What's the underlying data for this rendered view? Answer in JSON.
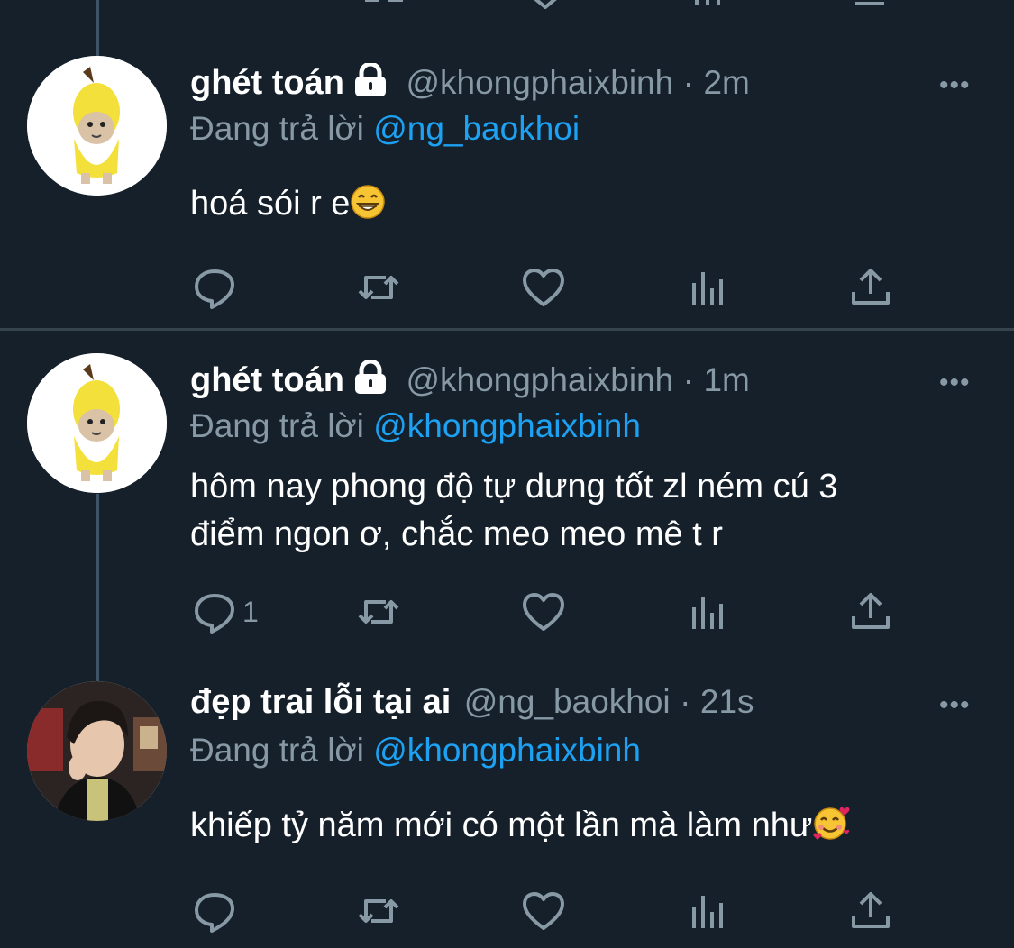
{
  "tweets": [
    {
      "display_name": "ghét toán",
      "locked": true,
      "handle": "@khongphaixbinh",
      "time": "2m",
      "reply_prefix": "Đang trả lời",
      "reply_to": "@ng_baokhoi",
      "lines": [
        "hoá sói r e"
      ],
      "emoji": "grinning-face",
      "reply_count": "",
      "avatar": "banana-cat-avatar"
    },
    {
      "display_name": "ghét toán",
      "locked": true,
      "handle": "@khongphaixbinh",
      "time": "1m",
      "reply_prefix": "Đang trả lời",
      "reply_to": "@khongphaixbinh",
      "lines": [
        "hôm nay phong độ tự dưng tốt zl ném cú 3",
        "điểm ngon ơ, chắc meo meo mê t r"
      ],
      "emoji": "",
      "reply_count": "1",
      "avatar": "banana-cat-avatar"
    },
    {
      "display_name": "đẹp trai lỗi tại ai",
      "locked": false,
      "handle": "@ng_baokhoi",
      "time": "21s",
      "reply_prefix": "Đang trả lời",
      "reply_to": "@khongphaixbinh",
      "lines": [
        "khiếp tỷ năm mới có một lần mà làm như"
      ],
      "emoji": "smiling-face-with-hearts",
      "reply_count": "",
      "avatar": "person-photo-avatar"
    }
  ],
  "separator": "·",
  "more_label": "•••",
  "icons": [
    "reply-icon",
    "retweet-icon",
    "like-icon",
    "analytics-icon",
    "share-icon"
  ],
  "colors": {
    "background": "#15202b",
    "secondary_text": "#8899a6",
    "link": "#1da1f2",
    "divider": "#38444d"
  }
}
